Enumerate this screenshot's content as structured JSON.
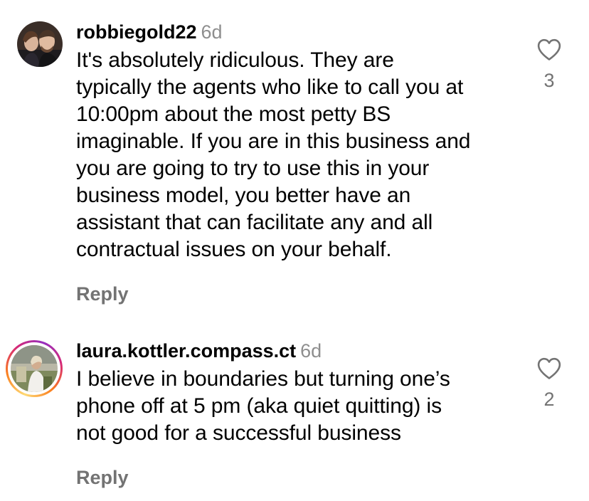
{
  "comments": [
    {
      "username": "robbiegold22",
      "timestamp": "6d",
      "lines": [
        "It's absolutely ridiculous. They are",
        "typically the agents who like to call you at",
        "10:00pm about the most petty BS",
        "imaginable. If you are in this business and",
        "you are going to try to use this in your",
        "business model, you better have an",
        "assistant that can facilitate any and all",
        "contractual issues on your behalf."
      ],
      "reply_label": "Reply",
      "like_count": "3",
      "like_icon": "heart-outline-icon",
      "has_story_ring": false
    },
    {
      "username": "laura.kottler.compass.ct",
      "timestamp": "6d",
      "lines": [
        "I believe in boundaries but turning one’s",
        "phone off at 5 pm (aka quiet quitting) is",
        "not good for a successful business"
      ],
      "reply_label": "Reply",
      "like_count": "2",
      "like_icon": "heart-outline-icon",
      "has_story_ring": true
    }
  ],
  "colors": {
    "text": "#000000",
    "secondary": "#737373",
    "timestamp": "#8e8e8e",
    "background": "#ffffff"
  }
}
